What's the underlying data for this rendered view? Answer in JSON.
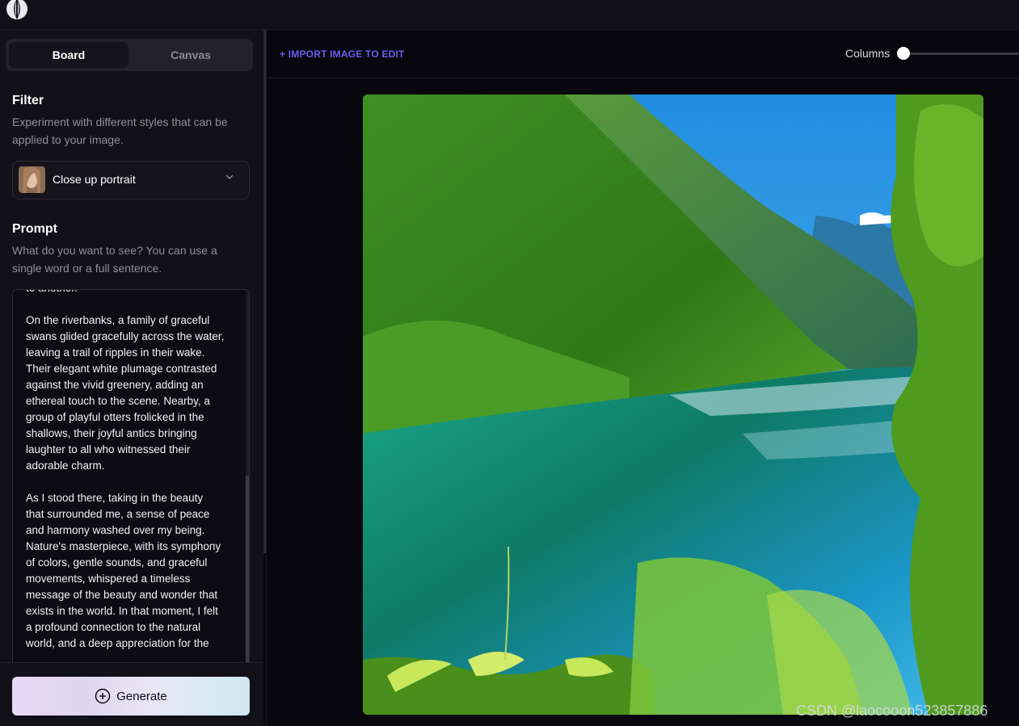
{
  "tabs": {
    "board": "Board",
    "canvas": "Canvas"
  },
  "filter": {
    "title": "Filter",
    "description": "Experiment with different styles that can be applied to your image.",
    "selected": "Close up portrait"
  },
  "prompt": {
    "title": "Prompt",
    "description": "What do you want to see? You can use a single word or a full sentence.",
    "text": "to another.\n\nOn the riverbanks, a family of graceful\nswans glided gracefully across the water,\nleaving a trail of ripples in their wake.\nTheir elegant white plumage contrasted\nagainst the vivid greenery, adding an\nethereal touch to the scene. Nearby, a\ngroup of playful otters frolicked in the\nshallows, their joyful antics bringing\nlaughter to all who witnessed their\nadorable charm.\n\nAs I stood there, taking in the beauty\nthat surrounded me, a sense of peace\nand harmony washed over my being.\nNature's masterpiece, with its symphony\nof colors, gentle sounds, and graceful\nmovements, whispered a timeless\nmessage of the beauty and wonder that\nexists in the world. In that moment, I felt\na profound connection to the natural\nworld, and a deep appreciation for the"
  },
  "generate_label": "Generate",
  "toolbar": {
    "import_label": "+ IMPORT IMAGE TO EDIT",
    "columns_label": "Columns"
  },
  "watermark": "CSDN @laocooon523857886",
  "colors": {
    "accent": "#6c5bf0",
    "background": "#08070d",
    "panel": "#121119"
  }
}
